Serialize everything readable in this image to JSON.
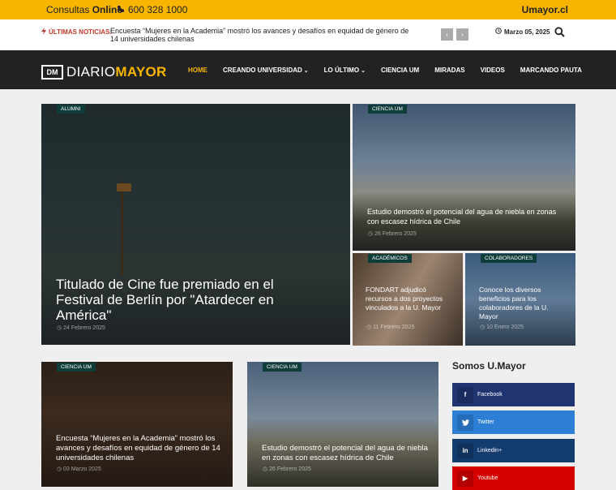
{
  "topbar": {
    "consult_prefix": "Consultas",
    "consult_bold": "Online",
    "phone": "600 328 1000",
    "site_link": "Umayor.cl"
  },
  "newsbar": {
    "label": "ÚLTIMAS NOTICIAS:",
    "headline": "Encuesta “Mujeres en la Academia” mostró los avances y desafíos en equidad de género de 14 universidades chilenas",
    "date": "Marzo 05, 2025"
  },
  "logo": {
    "mark": "DM",
    "diario": "DIARIO",
    "mayor": "MAYOR"
  },
  "nav": {
    "items": [
      {
        "label": "HOME",
        "dropdown": false
      },
      {
        "label": "CREANDO UNIVERSIDAD",
        "dropdown": true
      },
      {
        "label": "LO ÚLTIMO",
        "dropdown": true
      },
      {
        "label": "CIENCIA UM",
        "dropdown": false
      },
      {
        "label": "MIRADAS",
        "dropdown": false
      },
      {
        "label": "VIDEOS",
        "dropdown": false
      },
      {
        "label": "MARCANDO PAUTA",
        "dropdown": false
      }
    ]
  },
  "cards": {
    "c1": {
      "tag": "ALUMNI",
      "title": "Titulado de Cine fue premiado en el Festival de Berlín por \"Atardecer en América\"",
      "date": "24 Febrero 2025"
    },
    "c2": {
      "tag": "CIENCIA UM",
      "title": "Estudio demostró el potencial del agua de niebla en zonas con escasez hídrica de Chile",
      "date": "26 Febrero 2025"
    },
    "c3": {
      "tag": "ACADÉMICOS",
      "title": "FONDART adjudicó recursos a dos proyectos vinculados a la U. Mayor",
      "date": "11 Febrero 2025"
    },
    "c4": {
      "tag": "COLABORADORES",
      "title": "Conoce los diversos beneficios para los colaboradores de la U. Mayor",
      "date": "10 Enero 2025"
    },
    "c5": {
      "tag": "CIENCIA UM",
      "title": "Encuesta “Mujeres en la Academia” mostró los avances y desafíos en equidad de género de 14 universidades chilenas",
      "date": "03 Marzo 2025"
    },
    "c6": {
      "tag": "CIENCIA UM",
      "title": "Estudio demostró el potencial del agua de niebla en zonas con escasez hídrica de Chile",
      "date": "26 Febrero 2025"
    }
  },
  "sidebar": {
    "title": "Somos U.Mayor",
    "social": [
      {
        "label": "Facebook",
        "icon": "facebook-icon",
        "glyph": "f"
      },
      {
        "label": "Twitter",
        "icon": "twitter-icon",
        "glyph": "t"
      },
      {
        "label": "Linkedin+",
        "icon": "linkedin-icon",
        "glyph": "in"
      },
      {
        "label": "Youtube",
        "icon": "youtube-icon",
        "glyph": "▶"
      }
    ]
  },
  "colors": {
    "accent": "#f7b500",
    "nav_bg": "#222222",
    "tag_bg": "#0f3d3a",
    "breaking": "#c0392b"
  }
}
